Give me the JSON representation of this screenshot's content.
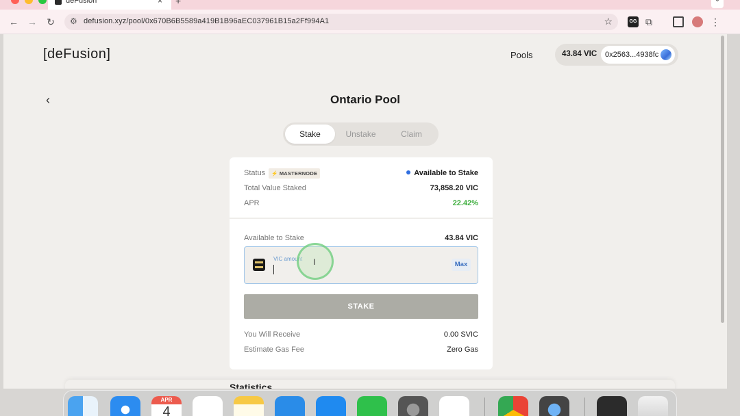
{
  "browser": {
    "tab_title": "deFusion",
    "tab_close": "×",
    "new_tab": "+",
    "url": "defusion.xyz/pool/0x670B6B5589a419B1B96aEC037961B15a2Ff994A1",
    "ext_label": "GG",
    "icons": {
      "back": "←",
      "forward": "→",
      "reload": "↻",
      "site_info": "⚙",
      "star": "☆",
      "puzzle": "⧉",
      "menu": "⋮",
      "tab_menu": "⌄"
    }
  },
  "header": {
    "logo": "[deFusion]",
    "nav_pools": "Pools",
    "balance": "43.84 VIC",
    "address": "0x2563...4938fc"
  },
  "pool": {
    "back_icon": "‹",
    "title": "Ontario Pool",
    "tabs": [
      {
        "label": "Stake",
        "active": true
      },
      {
        "label": "Unstake",
        "active": false
      },
      {
        "label": "Claim",
        "active": false
      }
    ],
    "status_label": "Status",
    "status_badge": "⚡ MASTERNODE",
    "status_value": "Available to Stake",
    "tvs_label": "Total Value Staked",
    "tvs_value": "73,858.20 VIC",
    "apr_label": "APR",
    "apr_value": "22.42%"
  },
  "stake_form": {
    "available_label": "Available to Stake",
    "available_value": "43.84 VIC",
    "input_label": "VIC amount",
    "input_value": "",
    "max_label": "Max",
    "stake_button": "STAKE",
    "receive_label": "You Will Receive",
    "receive_value": "0.00 SVIC",
    "gas_label": "Estimate Gas Fee",
    "gas_value": "Zero Gas",
    "ibeam_cursor": "I"
  },
  "statistics_heading": "Statistics",
  "dock": {
    "calendar_month": "APR",
    "calendar_day": "4",
    "apps": [
      "finder",
      "safari",
      "calendar",
      "reminders",
      "notes",
      "keynote",
      "app-store",
      "numbers",
      "system-settings",
      "slack",
      "chrome",
      "proxyman",
      "terminal",
      "trash"
    ]
  },
  "colors": {
    "accent_blue": "#2f6ee0",
    "apr_green": "#3fae3f",
    "stake_button_disabled": "#acaca5",
    "page_bg": "#f1efec"
  }
}
